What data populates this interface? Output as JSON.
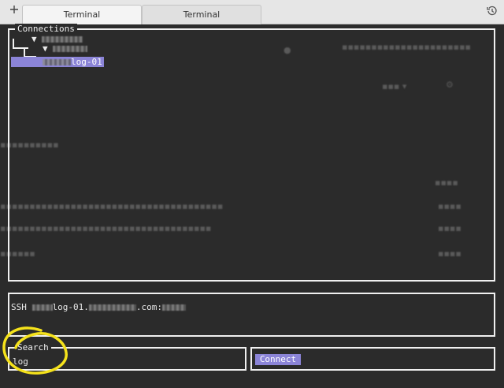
{
  "tabbar": {
    "add_icon": "plus-icon",
    "close_icon": "close-icon",
    "tabs": [
      {
        "label": "Terminal"
      },
      {
        "label": "Terminal"
      }
    ],
    "history_icon": "history-icon"
  },
  "connections": {
    "title": "Connections",
    "selected_item_suffix": "log-01"
  },
  "details": {
    "protocol": "SSH",
    "host_fragment": "log-01.",
    "domain_suffix": ".com:"
  },
  "search": {
    "title": "Search",
    "value": "log"
  },
  "connect": {
    "label": "Connect"
  },
  "colors": {
    "selection": "#8b84d7",
    "frame": "#f0f0f0",
    "background": "#2b2b2b",
    "annotation": "#f5e21b"
  }
}
